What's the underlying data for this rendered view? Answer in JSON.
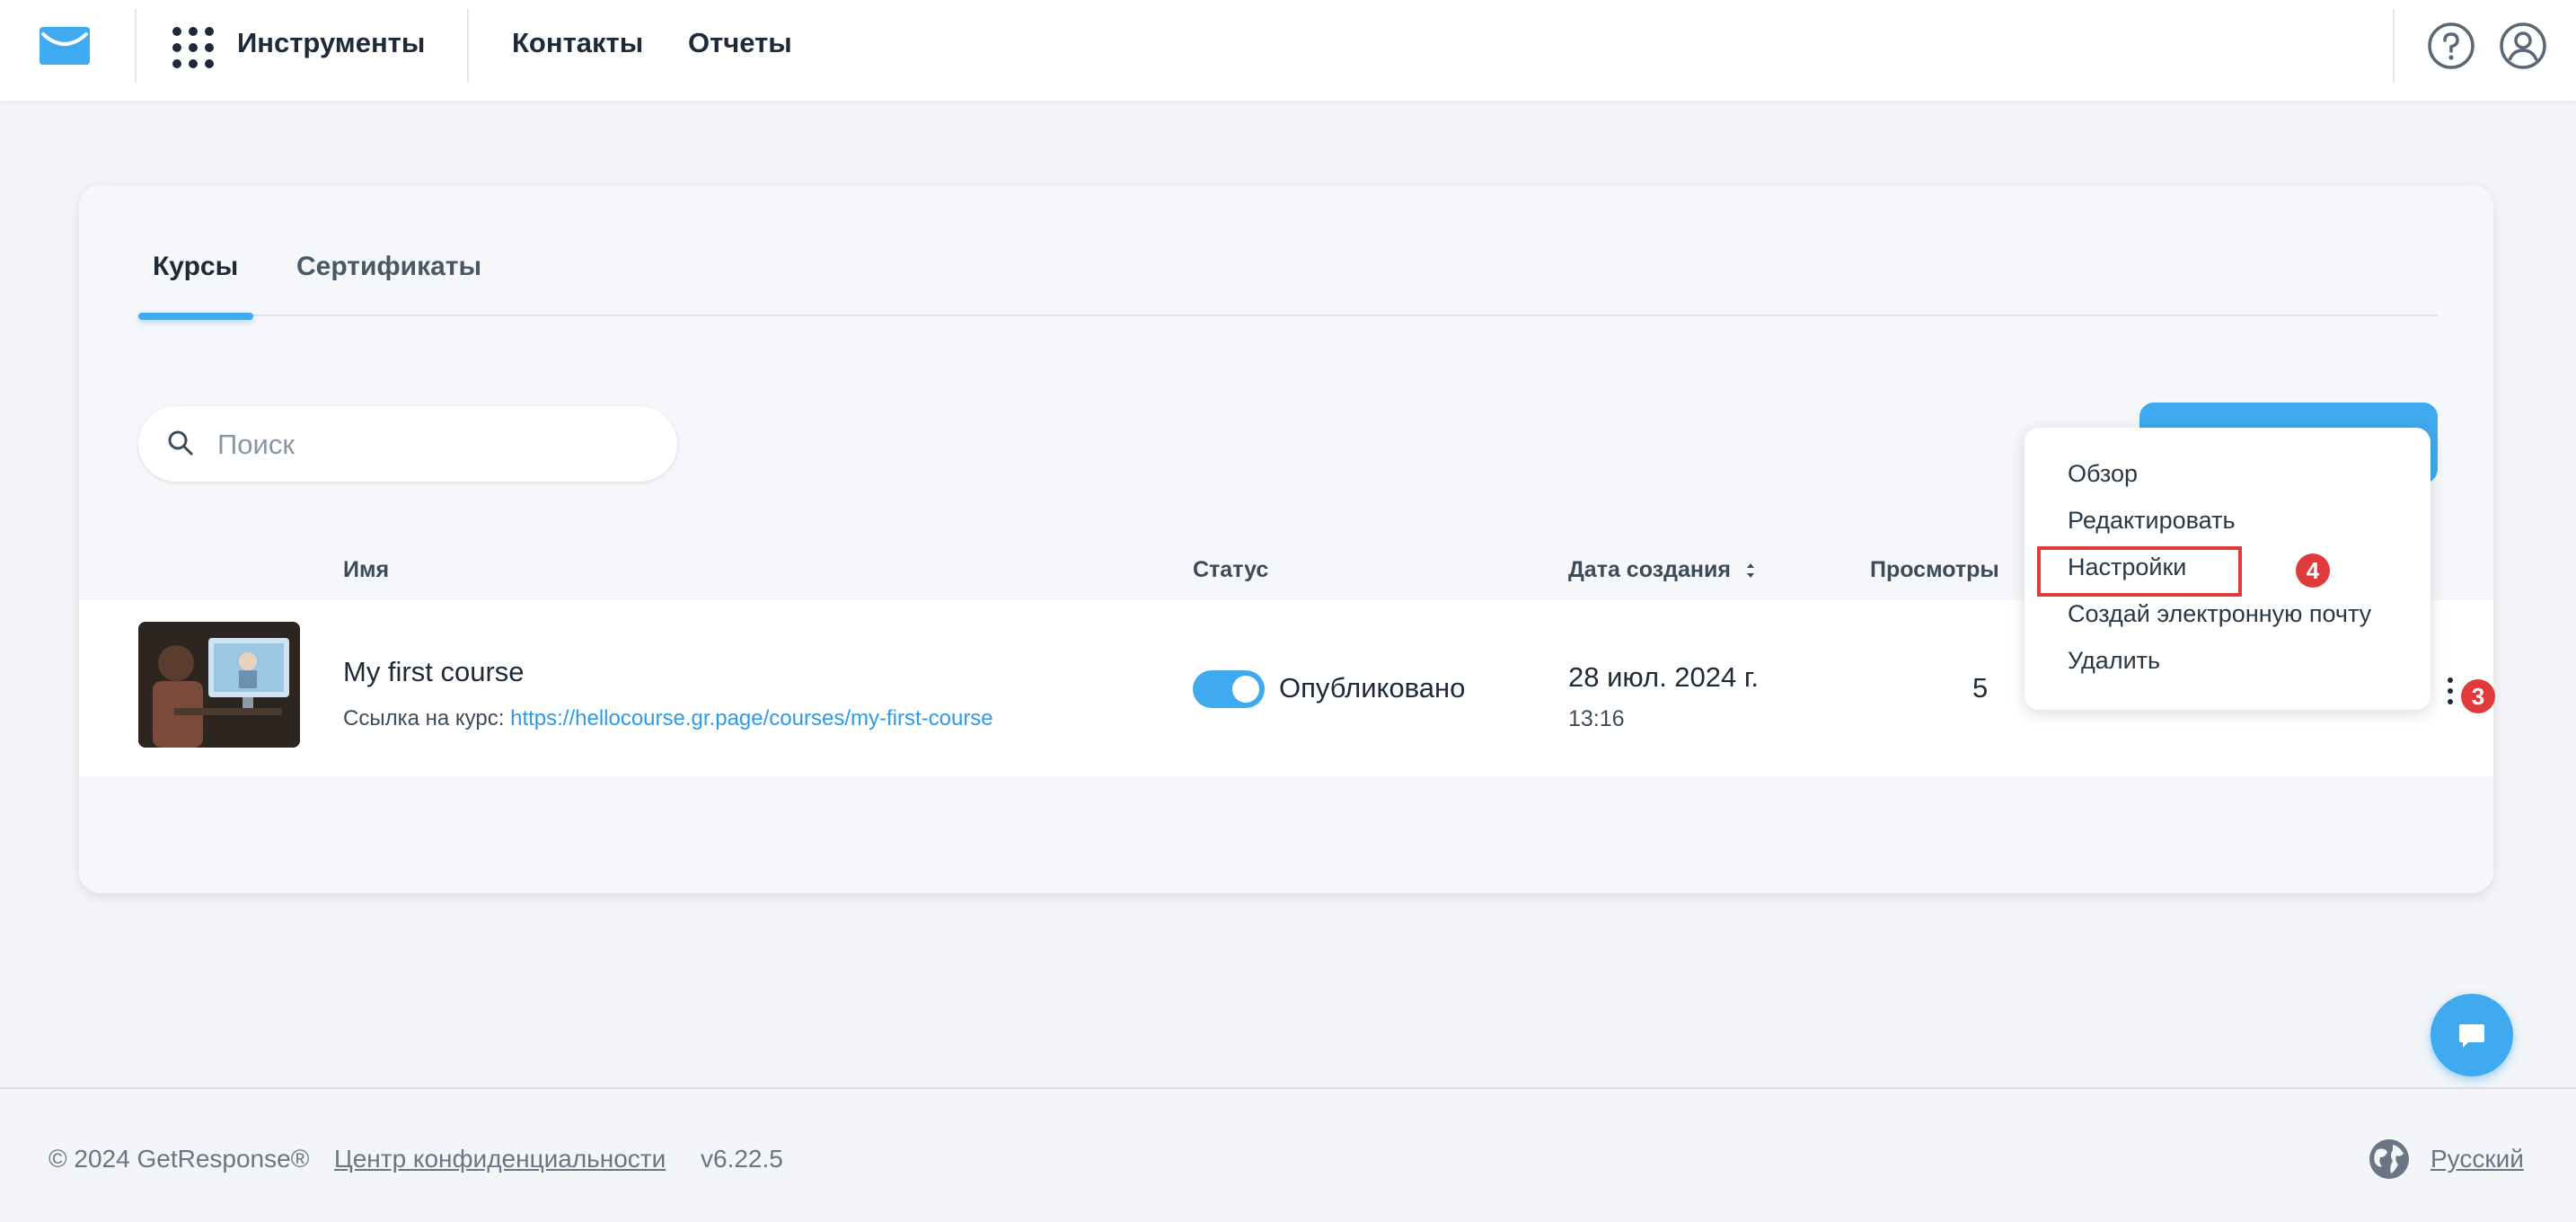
{
  "header": {
    "nav": [
      "Инструменты",
      "Контакты",
      "Отчеты"
    ]
  },
  "tabs": [
    {
      "label": "Курсы",
      "active": true
    },
    {
      "label": "Сертификаты",
      "active": false
    }
  ],
  "search": {
    "placeholder": "Поиск",
    "value": ""
  },
  "table": {
    "columns": [
      "Имя",
      "Статус",
      "Дата создания",
      "Просмотры"
    ],
    "rows": [
      {
        "name": "My first course",
        "link_label": "Ссылка на курс:",
        "link": "https://hellocourse.gr.page/courses/my-first-course",
        "status": "Опубликовано",
        "published": true,
        "date": "28 июл. 2024 г.",
        "time": "13:16",
        "views": "5"
      }
    ]
  },
  "dropdown": {
    "items": [
      "Обзор",
      "Редактировать",
      "Настройки",
      "Создай электронную почту",
      "Удалить"
    ],
    "highlighted_index": 2
  },
  "annotations": {
    "menu_badge": "3",
    "settings_badge": "4"
  },
  "footer": {
    "copyright": "© 2024 GetResponse®",
    "privacy": "Центр конфиденциальности",
    "version": "v6.22.5",
    "language": "Русский"
  },
  "colors": {
    "accent": "#3faaf0",
    "annotation": "#e03a3a"
  }
}
